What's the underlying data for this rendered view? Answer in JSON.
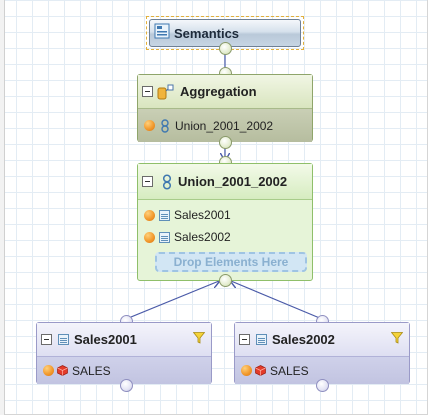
{
  "semantics": {
    "title": "Semantics"
  },
  "aggregation": {
    "title": "Aggregation",
    "items": [
      {
        "label": "Union_2001_2002"
      }
    ]
  },
  "union": {
    "title": "Union_2001_2002",
    "items": [
      {
        "label": "Sales2001"
      },
      {
        "label": "Sales2002"
      }
    ],
    "drop_zone": "Drop Elements Here"
  },
  "projections": [
    {
      "title": "Sales2001",
      "items": [
        {
          "label": "SALES"
        }
      ]
    },
    {
      "title": "Sales2002",
      "items": [
        {
          "label": "SALES"
        }
      ]
    }
  ],
  "colors": {
    "grid": "#e3ecf4",
    "aggregation_node": "#d9e5bf",
    "union_node": "#d6ecc0",
    "projection_node": "#d5d7ee",
    "drop_zone": "#d2e6f4",
    "connector": "#4a5aa8"
  },
  "icons": {
    "semantics": "semantics-icon",
    "aggregation": "aggregation-icon",
    "union": "union-icon",
    "projection": "table-icon",
    "filter": "filter-icon",
    "attribute": "attribute-dot-icon",
    "measure": "measure-cube-icon"
  }
}
